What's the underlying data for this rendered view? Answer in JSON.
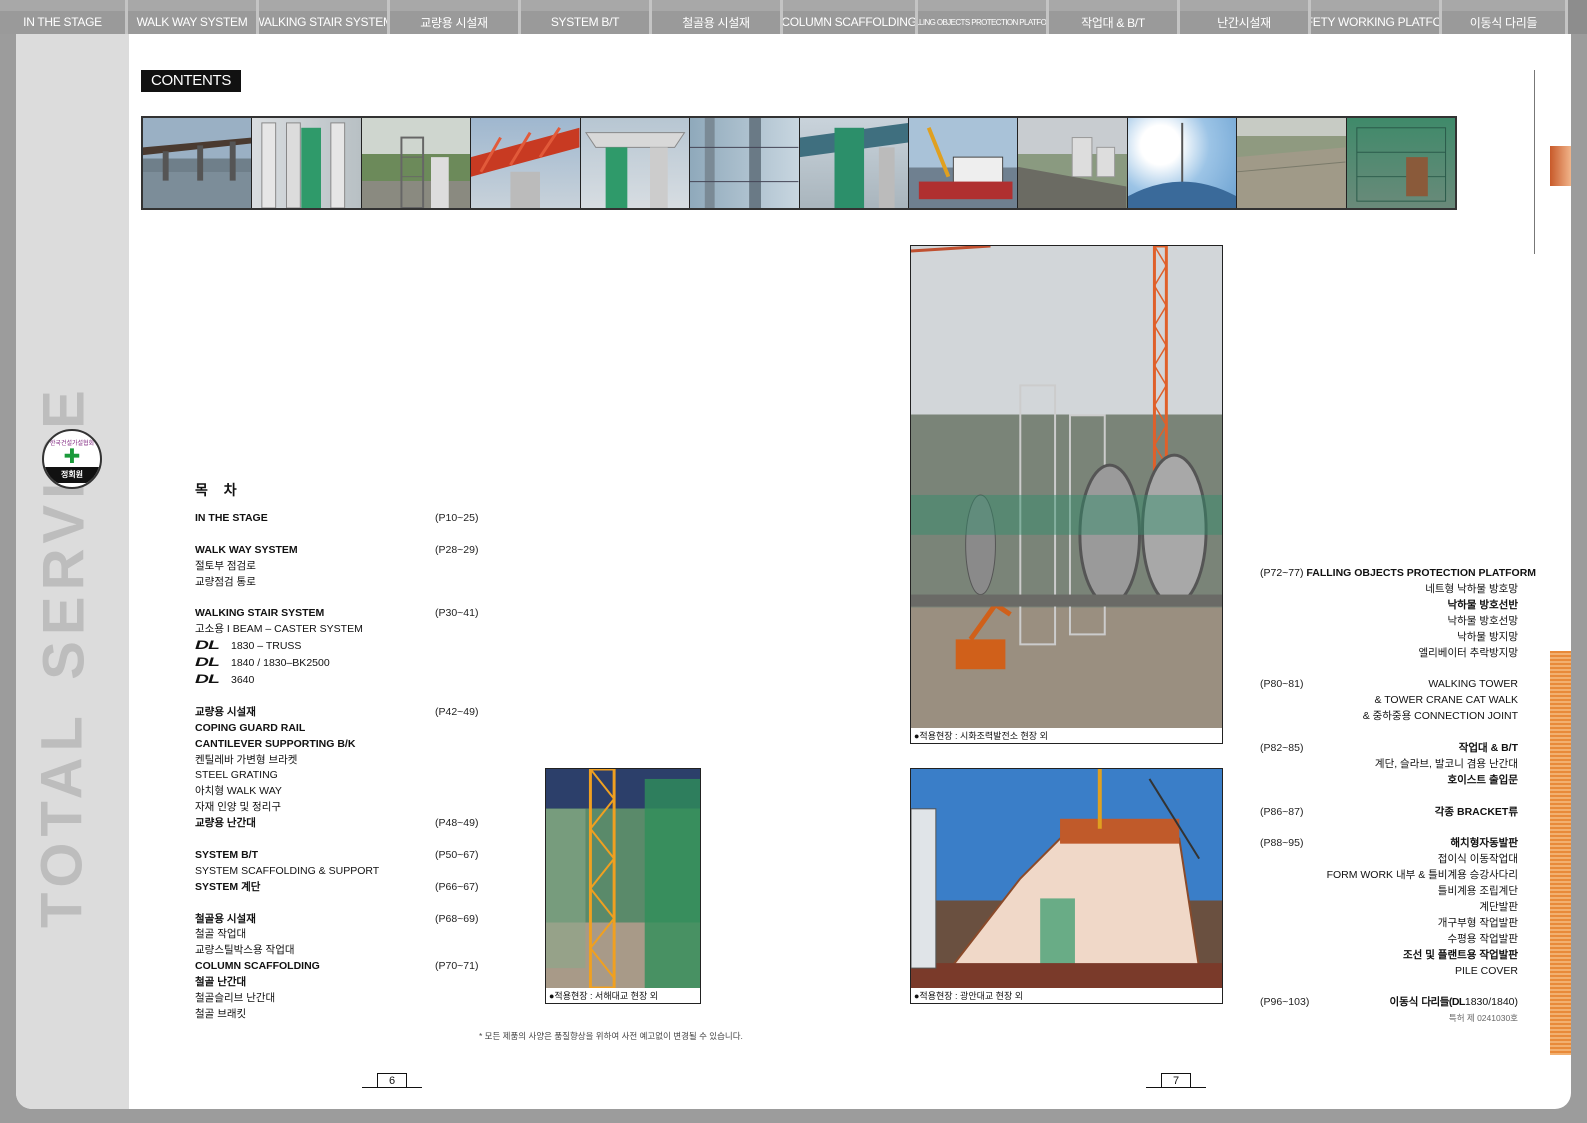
{
  "nav": {
    "tabs": [
      {
        "label": "IN THE STAGE",
        "width": 128
      },
      {
        "label": "WALK WAY SYSTEM",
        "width": 131
      },
      {
        "label": "WALKING STAIR SYSTEM",
        "width": 131
      },
      {
        "label": "교량용 시설재",
        "width": 131
      },
      {
        "label": "SYSTEM B/T",
        "width": 131
      },
      {
        "label": "철골용 시설재",
        "width": 131
      },
      {
        "label": "COLUMN SCAFFOLDING",
        "width": 135
      },
      {
        "label": "FALLING OBJECTS PROTECTION PLATFORM",
        "width": 131
      },
      {
        "label": "작업대 & B/T",
        "width": 131
      },
      {
        "label": "난간시설재",
        "width": 131
      },
      {
        "label": "SAFETY WORKING PLATFORM",
        "width": 131
      },
      {
        "label": "이동식 다리들",
        "width": 126
      }
    ]
  },
  "rail": {
    "word1": "TOTAL",
    "word2": "SERVICE",
    "seal_arc": "한국건설가설협회",
    "seal_name": "정회원"
  },
  "contents_label": "CONTENTS",
  "toc_title": "목 차",
  "toc_left": {
    "in_stage": {
      "label": "IN THE STAGE",
      "page": "(P10~25)"
    },
    "walkway": {
      "label": "WALK WAY SYSTEM",
      "page": "(P28~29)",
      "items": [
        "절토부 점검로",
        "교량점검 통로"
      ]
    },
    "stair": {
      "label": "WALKING STAIR SYSTEM",
      "page": "(P30~41)",
      "item1": "고소용 I BEAM – CASTER SYSTEM",
      "dl": "DL",
      "dl_items": [
        "1830 – TRUSS",
        "1840 / 1830–BK2500",
        "3640"
      ]
    },
    "bridge": {
      "label": "교량용 시설재",
      "page": "(P42~49)",
      "bold_items": [
        "COPING GUARD RAIL",
        "CANTILEVER SUPPORTING B/K"
      ],
      "items": [
        "켄틸레바 가변형 브라켓",
        "STEEL GRATING",
        "아치형 WALK WAY",
        "자재 인양 및 정리구"
      ],
      "rail_label": "교량용 난간대",
      "rail_page": "(P48~49)"
    },
    "system": {
      "label": "SYSTEM B/T",
      "page": "(P50~67)",
      "item": "SYSTEM SCAFFOLDING & SUPPORT",
      "stair_label": "SYSTEM 계단",
      "stair_page": "(P66~67)"
    },
    "steel": {
      "label": "철골용 시설재",
      "page": "(P68~69)",
      "items": [
        "철골 작업대",
        "교량스틸박스용 작업대"
      ],
      "col_label": "COLUMN SCAFFOLDING",
      "col_page": "(P70~71)",
      "rail_label": "철골 난간대",
      "items2": [
        "철골슬리브 난간대",
        "철골 브래킷"
      ]
    }
  },
  "toc_right": {
    "g1": {
      "page": "(P72~77)",
      "title": "FALLING OBJECTS PROTECTION PLATFORM",
      "lines": [
        {
          "t": "네트형 낙하물 방호망",
          "b": false
        },
        {
          "t": "낙하물 방호선반",
          "b": true
        },
        {
          "t": "낙하물 방호선망",
          "b": false
        },
        {
          "t": "낙하물 방지망",
          "b": false
        },
        {
          "t": "엘리베이터 추락방지망",
          "b": false
        }
      ]
    },
    "g2": {
      "page": "(P80~81)",
      "lines": [
        "WALKING TOWER",
        "& TOWER CRANE CAT WALK",
        "& 중하중용 CONNECTION JOINT"
      ]
    },
    "g3": {
      "page": "(P82~85)",
      "title": "작업대 & B/T",
      "line": "계단, 슬라브, 발코니 겸용 난간대",
      "bold": "호이스트 출입문"
    },
    "g4": {
      "page": "(P86~87)",
      "title": "각종 BRACKET류"
    },
    "g5": {
      "page": "(P88~95)",
      "title": "해치형자동발판",
      "lines": [
        {
          "t": "접이식 이동작업대",
          "b": false
        },
        {
          "t": "FORM WORK 내부 & 틀비계용 승강사다리",
          "b": false
        },
        {
          "t": "틀비계용 조립계단",
          "b": false
        },
        {
          "t": "계단발판",
          "b": false
        },
        {
          "t": "개구부형 작업발판",
          "b": false
        },
        {
          "t": "수평용 작업발판",
          "b": false
        },
        {
          "t": "조선 및 플랜트용 작업발판",
          "b": true
        },
        {
          "t": "PILE COVER",
          "b": false
        }
      ]
    },
    "g6": {
      "page": "(P96~103)",
      "prefix": "이동식",
      "brand": "다리들(DL",
      "suffix": "1830/1840)",
      "patent": "특허 제 0241030호"
    }
  },
  "photos": {
    "cap_plant": "●적용현장 : 시화조력발전소 현장 외",
    "cap_seohae": "●적용현장 : 서해대교 현장 외",
    "cap_gwangan": "●적용현장 : 광안대교 현장 외"
  },
  "footnote": "* 모든 제품의 사양은 품질향상을 위하여 사전 예고없이 변경될 수 있습니다.",
  "page_left": "6",
  "page_right": "7",
  "colors": {
    "accent": "#e88a3a",
    "tab_bg": "#9a9a9a",
    "rail": "#dcdcdc"
  }
}
